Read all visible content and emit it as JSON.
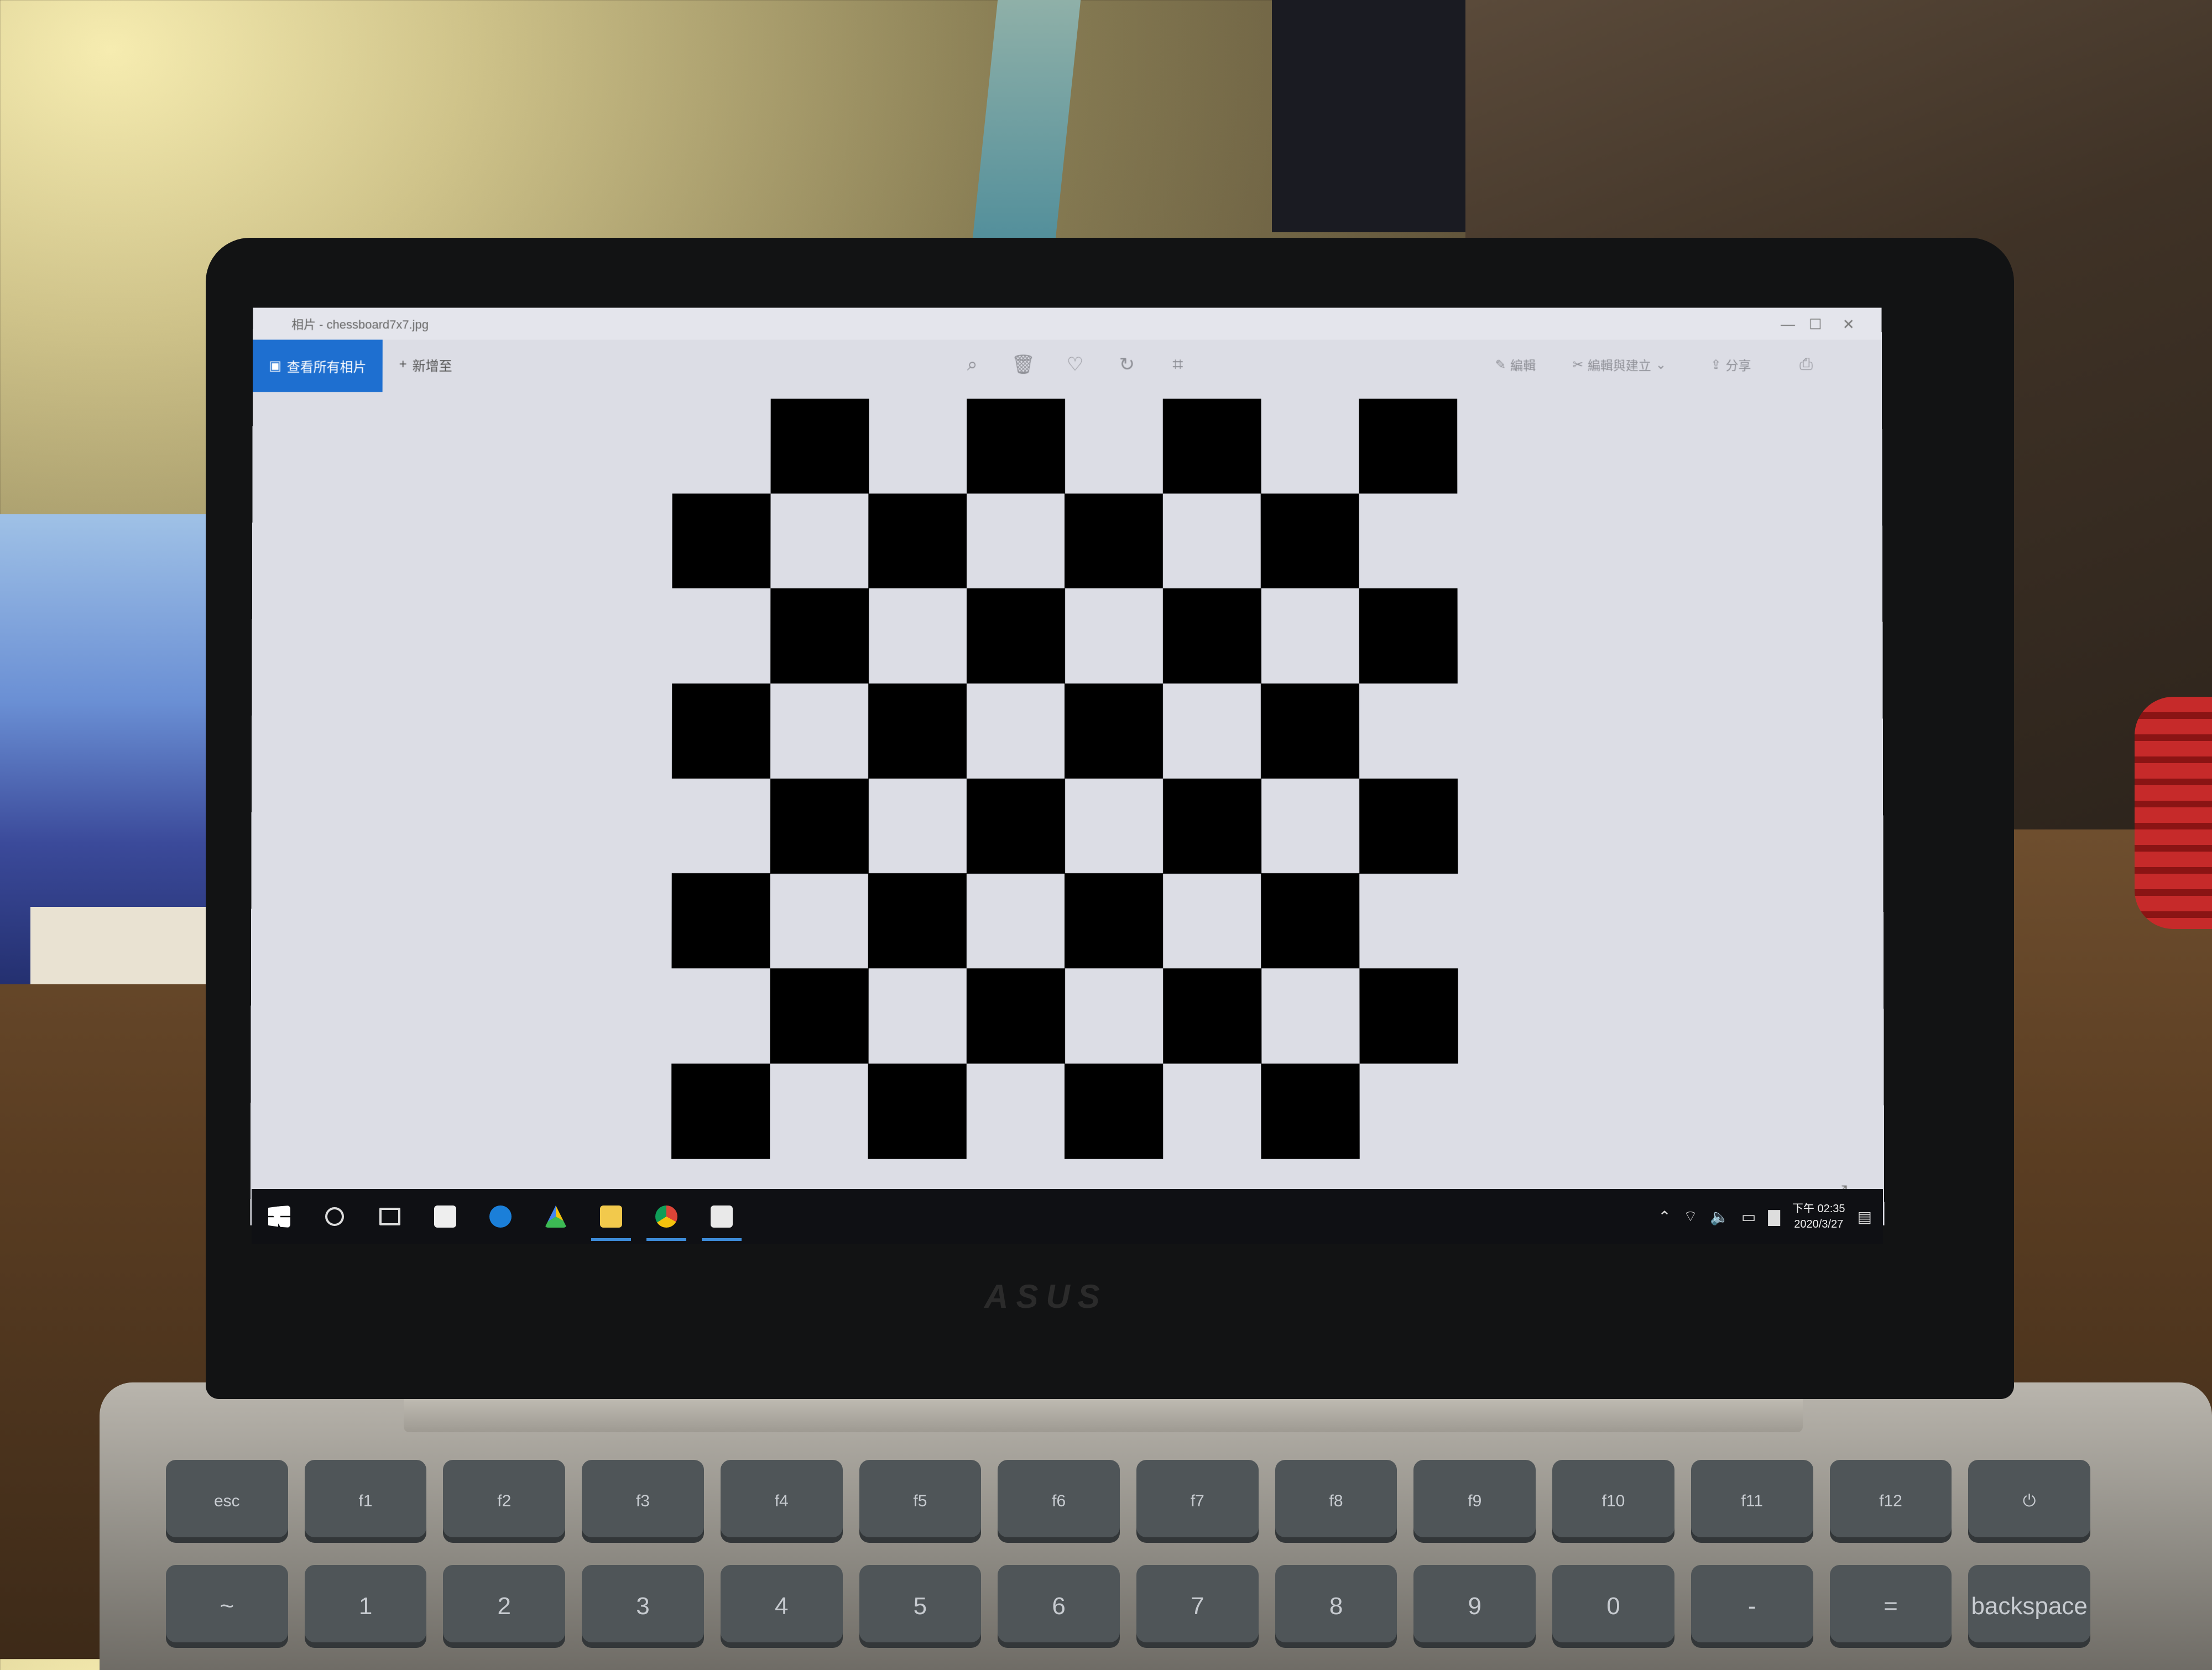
{
  "window": {
    "title": "相片 - chessboard7x7.jpg",
    "controls": {
      "minimize": "—",
      "maximize": "☐",
      "close": "✕"
    }
  },
  "toolbar": {
    "view_all_label": "查看所有相片",
    "add_to_label": "新增至",
    "edit_label": "編輯",
    "edit_create_label": "編輯與建立",
    "share_label": "分享",
    "icons": [
      "zoom-icon",
      "delete-icon",
      "favorite-icon",
      "rotate-icon",
      "crop-icon",
      "print-icon"
    ]
  },
  "image": {
    "rows": 8,
    "cols": 8,
    "colors": {
      "dark": "#000000",
      "light": "#dcdde5"
    }
  },
  "taskbar": {
    "apps": [
      "windows-start",
      "search",
      "task-view",
      "store",
      "edge",
      "google-drive",
      "file-explorer",
      "chrome",
      "photos"
    ],
    "clock": {
      "time": "下午 02:35",
      "date": "2020/3/27"
    }
  },
  "keyboard": {
    "fn_row": [
      "esc",
      "f1",
      "f2",
      "f3",
      "f4",
      "f5",
      "f6",
      "f7",
      "f8",
      "f9",
      "f10",
      "f11",
      "f12",
      "⏻"
    ],
    "num_row": [
      "~",
      "1",
      "2",
      "3",
      "4",
      "5",
      "6",
      "7",
      "8",
      "9",
      "0",
      "-",
      "=",
      "backspace"
    ]
  },
  "laptop": {
    "brand": "ASUS"
  },
  "colors": {
    "accent": "#1e6fd0",
    "taskbar": "#0f1014"
  }
}
